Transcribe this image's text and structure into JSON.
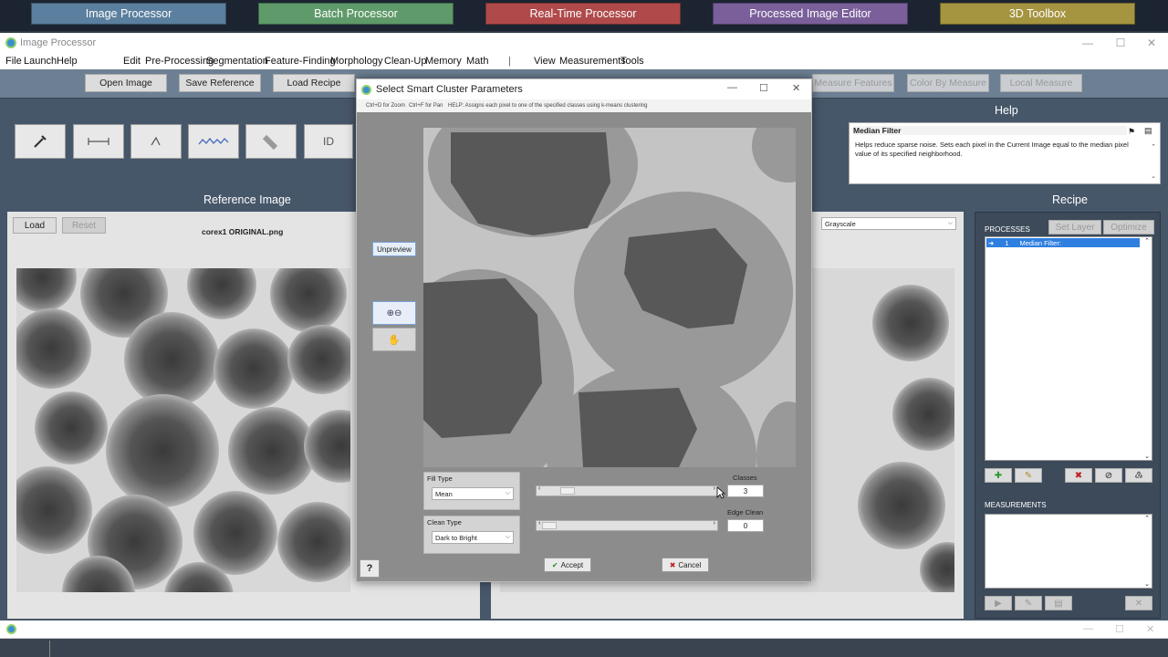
{
  "launcher": {
    "buttons": [
      {
        "label": "Image Processor",
        "color": "#5b7f9e"
      },
      {
        "label": "Batch Processor",
        "color": "#5f9a6a"
      },
      {
        "label": "Real-Time Processor",
        "color": "#b04a4a"
      },
      {
        "label": "Processed Image Editor",
        "color": "#7a5f9a"
      },
      {
        "label": "3D Toolbox",
        "color": "#a59440"
      }
    ]
  },
  "window": {
    "title": "Image Processor"
  },
  "menu": {
    "left": [
      "File",
      "Launch",
      "Help"
    ],
    "main": [
      "Edit",
      "Pre-Processing",
      "Segmentation",
      "Feature-Finding",
      "Morphology",
      "Clean-Up",
      "Memory",
      "Math"
    ],
    "separator": "|",
    "right": [
      "View",
      "Measurements",
      "Tools"
    ]
  },
  "toolbar": {
    "open_image": "Open Image",
    "save_reference": "Save Reference",
    "load_recipe": "Load Recipe",
    "measure_features": "Measure Features",
    "color_by_measure": "Color By Measure",
    "local_measure": "Local Measure"
  },
  "tools": {
    "id_label": "ID"
  },
  "help": {
    "section": "Help",
    "title": "Median Filter",
    "text": "Helps reduce sparse noise. Sets each pixel in the Current Image equal to the median pixel value of its specified neighborhood."
  },
  "reference": {
    "section": "Reference Image",
    "load": "Load",
    "reset": "Reset",
    "filename": "corex1 ORIGINAL.png"
  },
  "current": {
    "mode": "Grayscale"
  },
  "recipe": {
    "section": "Recipe",
    "processes_label": "PROCESSES",
    "set_layer": "Set Layer",
    "optimize": "Optimize",
    "items": [
      {
        "index": "1",
        "name": "Median Filter:"
      }
    ],
    "measurements_label": "MEASUREMENTS"
  },
  "dialog": {
    "title": "Select Smart Cluster Parameters",
    "hint_zoom": "Ctrl+D for Zoom",
    "hint_pan": "Ctrl+F for Pan",
    "hint_help": "HELP: Assigns each pixel to one of the specified classes using k-means clustering",
    "unpreview": "Unpreview",
    "fill_type_label": "Fill Type",
    "fill_type_value": "Mean",
    "clean_type_label": "Clean Type",
    "clean_type_value": "Dark to Bright",
    "classes_label": "Classes",
    "classes_value": "3",
    "edge_clean_label": "Edge Clean",
    "edge_clean_value": "0",
    "accept": "Accept",
    "cancel": "Cancel",
    "help_button": "?"
  }
}
